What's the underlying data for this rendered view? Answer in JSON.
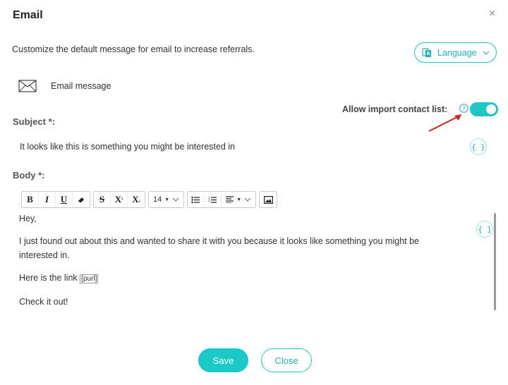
{
  "dialog": {
    "title": "Email",
    "close_glyph": "×",
    "description": "Customize the default message for email to increase referrals."
  },
  "language": {
    "label": "Language"
  },
  "email_message": {
    "label": "Email message"
  },
  "import_contacts": {
    "label": "Allow import contact list:",
    "enabled": true
  },
  "subject": {
    "label": "Subject *:",
    "value": "It looks like this is something you might be interested in"
  },
  "body": {
    "label": "Body *:",
    "toolbar": {
      "bold": "B",
      "italic": "I",
      "underline": "U",
      "strike": "S",
      "superscript": "X",
      "subscript": "X",
      "font_size": "14"
    },
    "paragraphs": [
      "Hey,",
      "I just found out about this and wanted to share it with you because it looks like something you might be interested in.",
      "Here is the link",
      "Check it out!"
    ],
    "purl_token": "[purl]"
  },
  "token_glyph": "{ }",
  "footer": {
    "save_label": "Save",
    "close_label": "Close"
  },
  "colors": {
    "accent": "#1cc9c9",
    "arrow": "#d62020"
  }
}
